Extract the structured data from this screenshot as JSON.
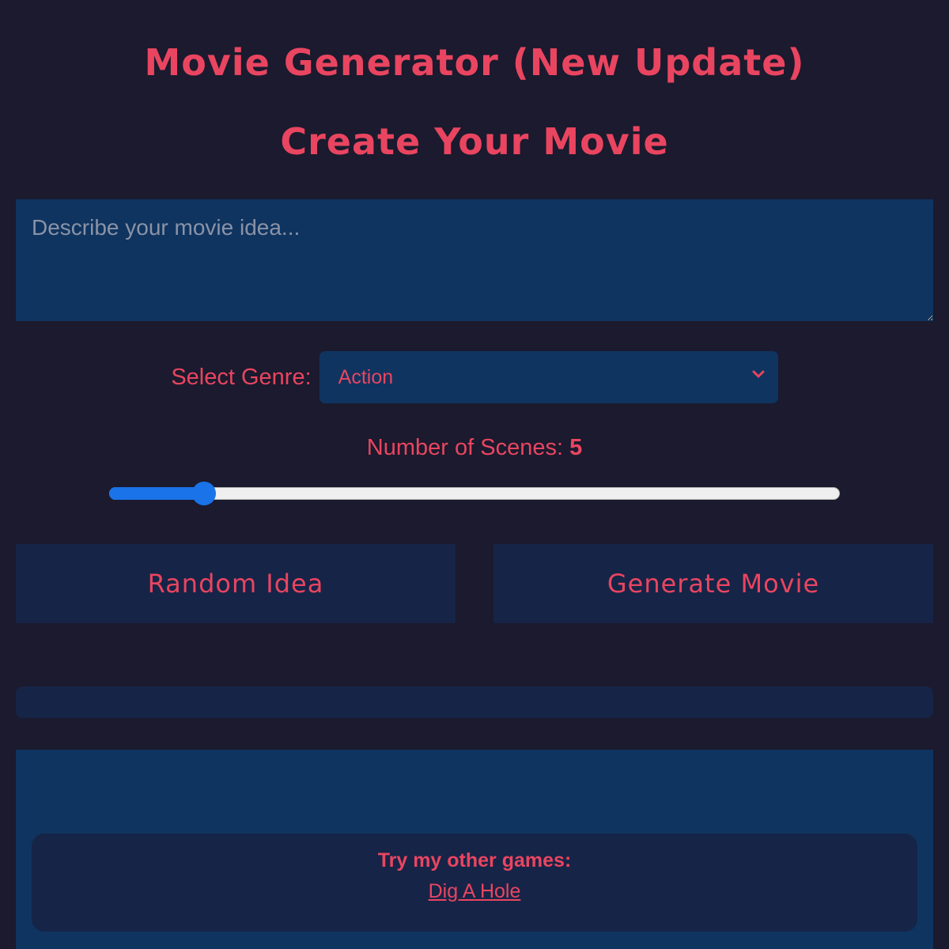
{
  "header": {
    "app_title": "Movie Generator (New Update)",
    "section_title": "Create Your Movie"
  },
  "idea_input": {
    "value": "",
    "placeholder": "Describe your movie idea..."
  },
  "genre": {
    "label": "Select Genre:",
    "selected": "Action"
  },
  "scenes": {
    "label": "Number of Scenes: ",
    "value": "5",
    "slider_fraction": 0.13
  },
  "buttons": {
    "random_label": "Random Idea",
    "generate_label": "Generate Movie"
  },
  "footer": {
    "heading": "Try my other games:",
    "link_label": "Dig A Hole"
  },
  "colors": {
    "background": "#1b1a2e",
    "accent": "#e94560",
    "panel": "#0f3460",
    "button": "#162447",
    "slider": "#1a73e8"
  }
}
